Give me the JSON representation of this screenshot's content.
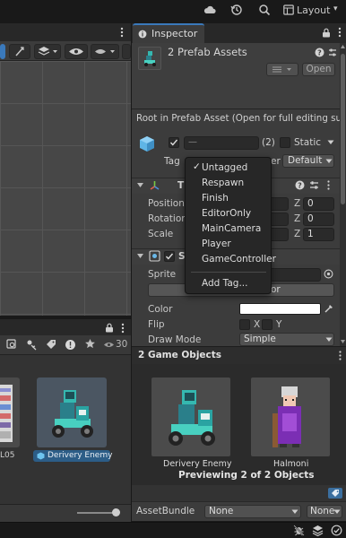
{
  "top_toolbar": {
    "layout_label": "Layout",
    "layout_arrow": "▾"
  },
  "inspector": {
    "tab_label": "Inspector",
    "tab_icon": "info-circle-icon",
    "title": "2 Prefab Assets",
    "open_button": "Open",
    "root_notice": "Root in Prefab Asset (Open for full editing supp",
    "object_name_value": "—",
    "object_count": "(2)",
    "static_label": "Static",
    "tag_label": "Tag",
    "layer_label": "er",
    "layer_value": "Default",
    "transform": {
      "title": "T",
      "position_label": "Position",
      "rotation_label": "Rotation",
      "scale_label": "Scale",
      "z_label": "Z",
      "z_position": "0",
      "z_rotation": "0",
      "z_scale": "1"
    },
    "sprite_renderer": {
      "title": "S",
      "sprite_label": "Sprite",
      "button_tail": "or",
      "color_label": "Color",
      "color_value": "#ffffff",
      "flip_label": "Flip",
      "flip_x": "X",
      "flip_y": "Y",
      "draw_mode_label": "Draw Mode",
      "draw_mode_value": "Simple"
    },
    "game_objects_header": "2 Game Objects",
    "preview_caption": "Previewing 2 of 2 Objects",
    "preview_items": [
      {
        "label": "Derivery Enemy"
      },
      {
        "label": "Halmoni"
      }
    ],
    "asset_bundle_label": "AssetBundle",
    "asset_bundle_value": "None",
    "asset_bundle_variant": "None"
  },
  "tag_dropdown": {
    "checked_item": "✓",
    "items": [
      "Untagged",
      "Respawn",
      "Finish",
      "EditorOnly",
      "MainCamera",
      "Player",
      "GameController"
    ],
    "add_tag": "Add Tag..."
  },
  "project": {
    "hidden_count": "30",
    "asset_left_label": "L05",
    "asset_selected_label": "Derivery Enemy"
  },
  "colors": {
    "accent": "#3a79bb",
    "panel": "#3c3c3c",
    "dark": "#191919",
    "field": "#2a2a2a"
  }
}
